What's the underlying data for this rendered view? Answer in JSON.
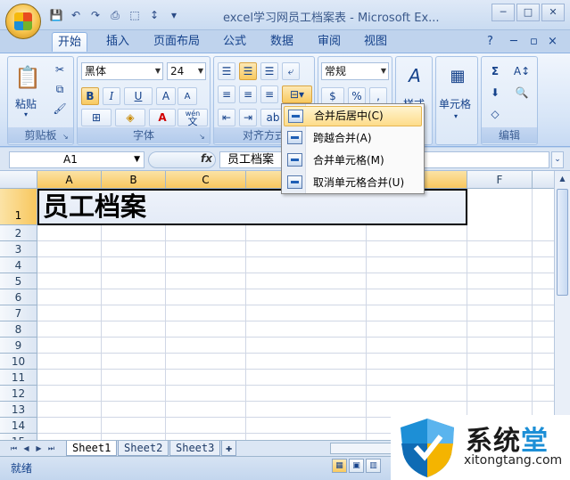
{
  "window": {
    "title": "excel学习网员工档案表 - Microsoft Ex...",
    "controls": [
      "─",
      "□",
      "✕"
    ]
  },
  "qat": [
    "save-icon",
    "undo-icon",
    "redo-icon",
    "print-preview-icon",
    "shape-icon",
    "sort-icon",
    "customize-icon"
  ],
  "tabs": [
    {
      "label": "开始",
      "active": true
    },
    {
      "label": "插入"
    },
    {
      "label": "页面布局"
    },
    {
      "label": "公式"
    },
    {
      "label": "数据"
    },
    {
      "label": "审阅"
    },
    {
      "label": "视图"
    }
  ],
  "ribbon": {
    "clipboard": {
      "label": "剪贴板",
      "paste": "粘贴"
    },
    "font": {
      "label": "字体",
      "name": "黑体",
      "size": "24",
      "bold": "B",
      "italic": "I",
      "underline": "U",
      "grow": "A",
      "shrink": "A",
      "wen": "wén",
      "wen_char": "文"
    },
    "alignment": {
      "label": "对齐方式"
    },
    "number": {
      "format": "常规",
      "percent": "%",
      "comma": ","
    },
    "styles": {
      "label": "样式"
    },
    "cells": {
      "label": "单元格"
    },
    "editing": {
      "label": "编辑",
      "sum": "Σ"
    }
  },
  "formula_bar": {
    "name_box": "A1",
    "fx": "fx",
    "content": "员工档案"
  },
  "grid": {
    "columns": [
      "A",
      "B",
      "C",
      "D",
      "E",
      "F"
    ],
    "rows": [
      "1",
      "2",
      "3",
      "4",
      "5",
      "6",
      "7",
      "8",
      "9",
      "10",
      "11",
      "12",
      "13",
      "14",
      "15"
    ],
    "merged_text": "员工档案"
  },
  "menu": {
    "items": [
      {
        "label": "合并后居中(C)",
        "hover": true
      },
      {
        "label": "跨越合并(A)"
      },
      {
        "label": "合并单元格(M)"
      },
      {
        "label": "取消单元格合并(U)"
      }
    ]
  },
  "sheets": [
    "Sheet1",
    "Sheet2",
    "Sheet3"
  ],
  "status": "就绪",
  "watermark": {
    "title_a": "系统",
    "title_b": "堂",
    "url": "xitongtang.com"
  }
}
